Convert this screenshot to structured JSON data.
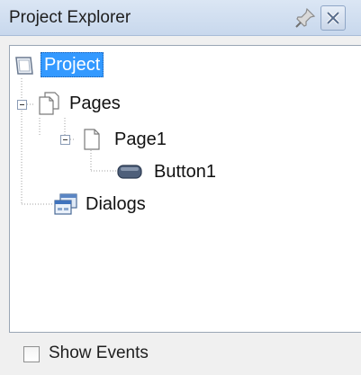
{
  "panel": {
    "title": "Project Explorer",
    "pin_icon": "pin-icon",
    "close_icon": "close-icon"
  },
  "tree": {
    "root": {
      "label": "Project",
      "icon": "project-icon",
      "selected": true
    },
    "pages": {
      "label": "Pages",
      "icon": "pages-icon",
      "expanded": true
    },
    "page1": {
      "label": "Page1",
      "icon": "page-icon",
      "expanded": true
    },
    "button1": {
      "label": "Button1",
      "icon": "button-icon"
    },
    "dialogs": {
      "label": "Dialogs",
      "icon": "dialogs-icon"
    }
  },
  "footer": {
    "show_events_label": "Show Events",
    "show_events_checked": false
  },
  "colors": {
    "selection": "#3399ff",
    "titlebar": "#d3e0f1",
    "tree_background": "#ffffff"
  }
}
